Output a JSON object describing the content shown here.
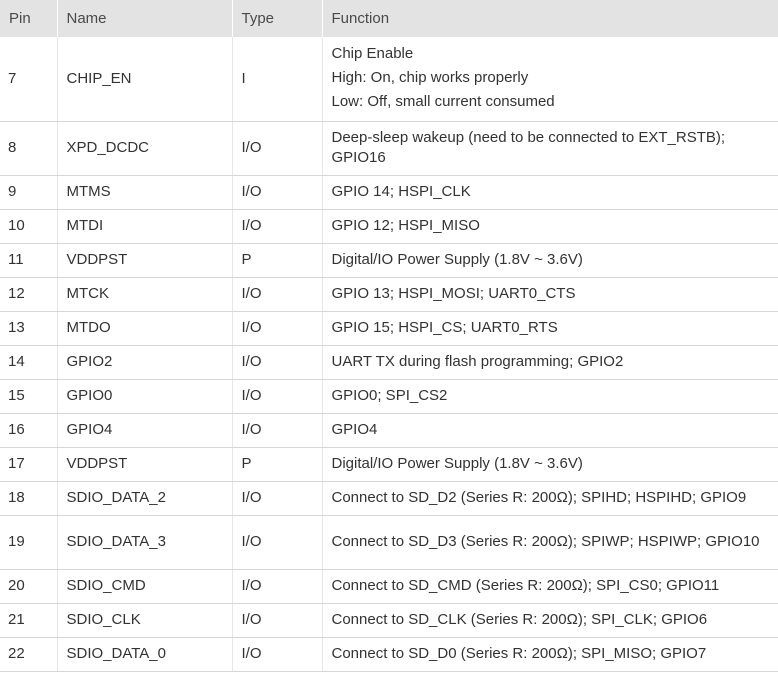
{
  "headers": {
    "pin": "Pin",
    "name": "Name",
    "type": "Type",
    "function": "Function"
  },
  "rows": [
    {
      "pin": "7",
      "name": "CHIP_EN",
      "type": "I",
      "function": [
        "Chip Enable",
        "High: On, chip works properly",
        "Low: Off, small current consumed"
      ]
    },
    {
      "pin": "8",
      "name": "XPD_DCDC",
      "type": "I/O",
      "function": [
        "Deep-sleep wakeup (need to be connected to EXT_RSTB); GPIO16"
      ]
    },
    {
      "pin": "9",
      "name": "MTMS",
      "type": "I/O",
      "function": [
        "GPIO 14; HSPI_CLK"
      ]
    },
    {
      "pin": "10",
      "name": "MTDI",
      "type": "I/O",
      "function": [
        "GPIO 12; HSPI_MISO"
      ]
    },
    {
      "pin": "11",
      "name": "VDDPST",
      "type": "P",
      "function": [
        "Digital/IO Power Supply (1.8V ~ 3.6V)"
      ]
    },
    {
      "pin": "12",
      "name": "MTCK",
      "type": "I/O",
      "function": [
        "GPIO 13; HSPI_MOSI; UART0_CTS"
      ]
    },
    {
      "pin": "13",
      "name": "MTDO",
      "type": "I/O",
      "function": [
        "GPIO 15; HSPI_CS; UART0_RTS"
      ]
    },
    {
      "pin": "14",
      "name": "GPIO2",
      "type": "I/O",
      "function": [
        "UART TX during flash programming; GPIO2"
      ]
    },
    {
      "pin": "15",
      "name": "GPIO0",
      "type": "I/O",
      "function": [
        "GPIO0; SPI_CS2"
      ]
    },
    {
      "pin": "16",
      "name": "GPIO4",
      "type": "I/O",
      "function": [
        "GPIO4"
      ]
    },
    {
      "pin": "17",
      "name": "VDDPST",
      "type": "P",
      "function": [
        "Digital/IO Power Supply (1.8V ~ 3.6V)"
      ]
    },
    {
      "pin": "18",
      "name": "SDIO_DATA_2",
      "type": "I/O",
      "function": [
        "Connect to SD_D2 (Series R: 200Ω); SPIHD; HSPIHD; GPIO9"
      ]
    },
    {
      "pin": "19",
      "name": "SDIO_DATA_3",
      "type": "I/O",
      "function": [
        "Connect to SD_D3 (Series R: 200Ω); SPIWP; HSPIWP; GPIO10"
      ]
    },
    {
      "pin": "20",
      "name": "SDIO_CMD",
      "type": "I/O",
      "function": [
        "Connect to SD_CMD (Series R: 200Ω); SPI_CS0; GPIO11"
      ]
    },
    {
      "pin": "21",
      "name": "SDIO_CLK",
      "type": "I/O",
      "function": [
        "Connect to SD_CLK (Series R: 200Ω); SPI_CLK; GPIO6"
      ]
    },
    {
      "pin": "22",
      "name": "SDIO_DATA_0",
      "type": "I/O",
      "function": [
        "Connect to SD_D0 (Series R: 200Ω); SPI_MISO; GPIO7"
      ]
    }
  ]
}
